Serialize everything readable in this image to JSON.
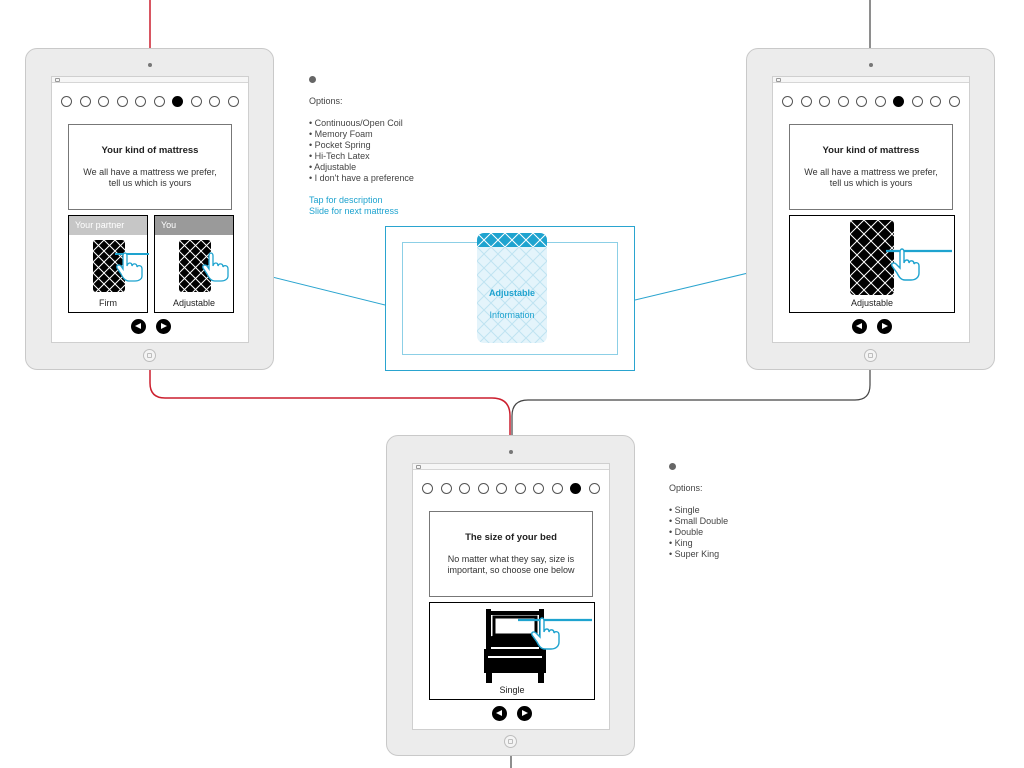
{
  "colors": {
    "partner_line": "#cc1f2e",
    "user_line": "#444444",
    "accent": "#1ea3cf"
  },
  "icons": [
    "mattress-icon",
    "swipe-hand-icon",
    "bed-icon",
    "prev-arrow-icon",
    "next-arrow-icon",
    "home-button-icon"
  ],
  "screen_left": {
    "progress": {
      "total": 10,
      "active": 7
    },
    "question": {
      "title": "Your kind of mattress",
      "subtitle": "We all have a mattress we prefer, tell us which is yours"
    },
    "cards": [
      {
        "tag": "Your partner",
        "label": "Firm"
      },
      {
        "tag": "You",
        "label": "Adjustable"
      }
    ]
  },
  "screen_right": {
    "progress": {
      "total": 10,
      "active": 7
    },
    "question": {
      "title": "Your kind of mattress",
      "subtitle": "We all have a mattress we prefer, tell us which is yours"
    },
    "card": {
      "label": "Adjustable"
    }
  },
  "screen_bottom": {
    "progress": {
      "total": 10,
      "active": 9
    },
    "question": {
      "title": "The size of your bed",
      "subtitle": "No matter what they say, size is important, so choose one below"
    },
    "card": {
      "label": "Single"
    }
  },
  "notes_mattress": {
    "heading": "Options:",
    "options": [
      "• Continuous/Open Coil",
      "• Memory Foam",
      "• Pocket Spring",
      "• Hi-Tech Latex",
      "• Adjustable",
      "• I don't have a preference"
    ],
    "hints": [
      "Tap for description",
      "Slide for next mattress"
    ]
  },
  "notes_size": {
    "heading": "Options:",
    "options": [
      "• Single",
      "• Small Double",
      "• Double",
      "• King",
      "• Super King"
    ]
  },
  "detail": {
    "title": "Adjustable",
    "subtitle": "Information"
  }
}
